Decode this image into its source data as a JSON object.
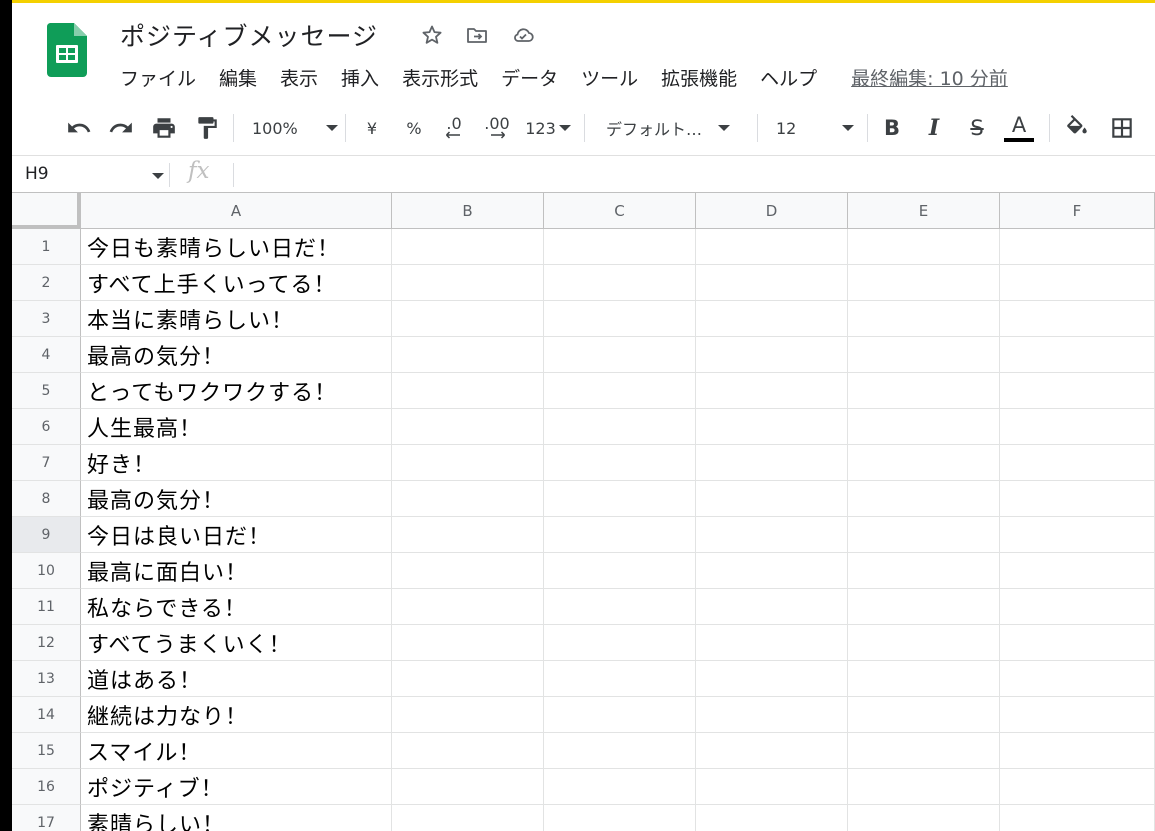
{
  "app": {
    "doc_title": "ポジティブメッセージ"
  },
  "menu": {
    "items": [
      "ファイル",
      "編集",
      "表示",
      "挿入",
      "表示形式",
      "データ",
      "ツール",
      "拡張機能",
      "ヘルプ"
    ],
    "last_edit": "最終編集: 10 分前"
  },
  "toolbar": {
    "zoom": "100%",
    "currency": "¥",
    "percent": "%",
    "decimal_decrease": ".0",
    "decimal_increase": ".00",
    "number_format": "123",
    "font": "デフォルト…",
    "font_size": "12",
    "bold": "B",
    "italic": "I",
    "strike": "S",
    "text_color_letter": "A"
  },
  "formula_bar": {
    "cell_ref": "H9",
    "fx": "fx"
  },
  "sheet": {
    "columns": [
      "A",
      "B",
      "C",
      "D",
      "E",
      "F"
    ],
    "selected_row": 9,
    "rows": [
      {
        "num": "1",
        "a": "今日も素晴らしい日だ！"
      },
      {
        "num": "2",
        "a": "すべて上手くいってる！"
      },
      {
        "num": "3",
        "a": "本当に素晴らしい！"
      },
      {
        "num": "4",
        "a": "最高の気分！"
      },
      {
        "num": "5",
        "a": "とってもワクワクする！"
      },
      {
        "num": "6",
        "a": "人生最高！"
      },
      {
        "num": "7",
        "a": "好き！"
      },
      {
        "num": "8",
        "a": "最高の気分！"
      },
      {
        "num": "9",
        "a": "今日は良い日だ！"
      },
      {
        "num": "10",
        "a": "最高に面白い！"
      },
      {
        "num": "11",
        "a": "私ならできる！"
      },
      {
        "num": "12",
        "a": "すべてうまくいく！"
      },
      {
        "num": "13",
        "a": "道はある！"
      },
      {
        "num": "14",
        "a": "継続は力なり！"
      },
      {
        "num": "15",
        "a": "スマイル！"
      },
      {
        "num": "16",
        "a": "ポジティブ！"
      },
      {
        "num": "17",
        "a": "素晴らしい！"
      }
    ]
  },
  "colors": {
    "sheets_green": "#0f9d58",
    "accent_yellow": "#f4d000"
  }
}
